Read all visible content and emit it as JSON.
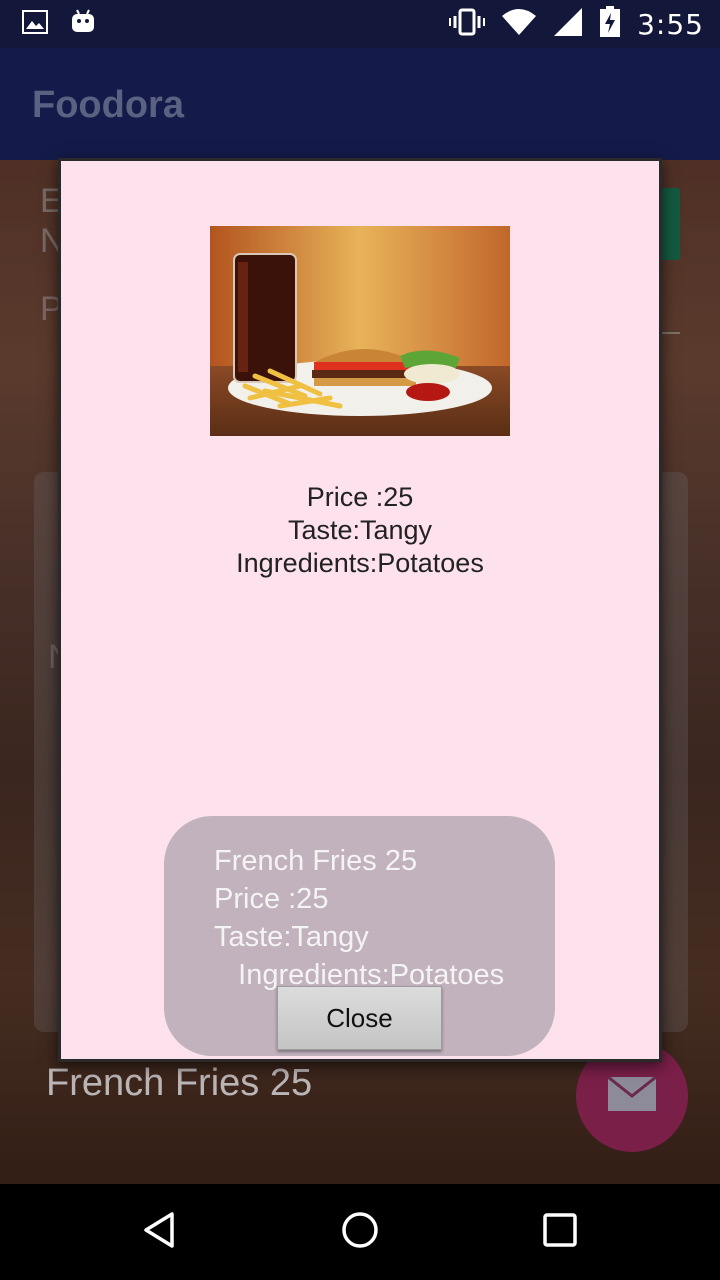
{
  "status_bar": {
    "time": "3:55",
    "icons": [
      "image-notification-icon",
      "android-notification-icon",
      "vibrate-icon",
      "wifi-icon",
      "cell-signal-icon",
      "battery-charging-icon"
    ]
  },
  "app_bar": {
    "title": "Foodora"
  },
  "background": {
    "list_item_label": "French Fries 25",
    "partial_letters": [
      "E",
      "N",
      "P",
      "N"
    ]
  },
  "dialog": {
    "image": "burger-fries-cola-image",
    "price": "Price :25",
    "taste": "Taste:Tangy",
    "ingredients": "Ingredients:Potatoes",
    "close_label": "Close"
  },
  "toast": {
    "line1": "French Fries 25",
    "line2": "Price :25",
    "line3": "Taste:Tangy",
    "line4": "   Ingredients:Potatoes"
  },
  "nav_bar": {
    "buttons": [
      "back-icon",
      "home-icon",
      "recents-icon"
    ]
  },
  "colors": {
    "status_bar": "#13183a",
    "app_bar": "#141b4a",
    "dialog_bg": "#fde1ec",
    "fab": "#7a1f48",
    "accent_green": "#1e8a63"
  }
}
